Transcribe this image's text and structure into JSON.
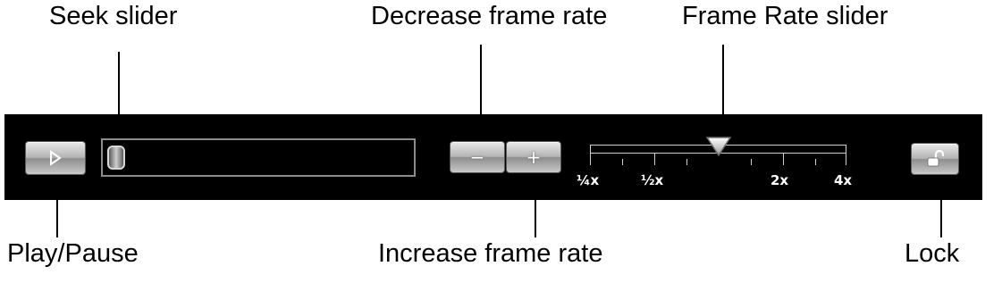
{
  "annotations": {
    "seek_slider": "Seek slider",
    "decrease_frame_rate": "Decrease frame rate",
    "frame_rate_slider": "Frame Rate slider",
    "play_pause": "Play/Pause",
    "increase_frame_rate": "Increase frame rate",
    "lock": "Lock"
  },
  "toolbar": {
    "play_icon": "play-triangle-icon",
    "decrease_label": "−",
    "increase_label": "+",
    "lock_icon": "unlocked-padlock-icon",
    "seek_position": 0.0,
    "frame_rate_position": 0.5,
    "rate_ticks": [
      "¼x",
      "½x",
      "2x",
      "4x"
    ]
  },
  "colors": {
    "toolbar_background": "#000000",
    "control_silver": "#b4b4b4",
    "tick_label": "#ffffff"
  }
}
